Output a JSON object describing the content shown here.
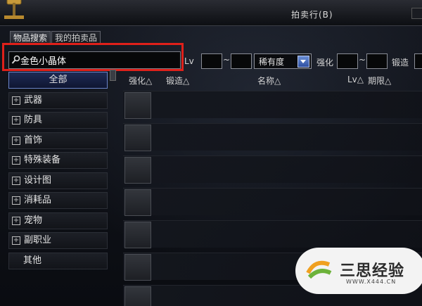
{
  "window": {
    "title": "拍卖行(B)"
  },
  "tabs": [
    {
      "label": "物品搜索"
    },
    {
      "label": "我的拍卖品"
    }
  ],
  "search": {
    "value": "金色小晶体"
  },
  "filters": {
    "lv_label": "Lv",
    "tilde": "~",
    "rarity_label": "稀有度",
    "enhance_label": "强化",
    "forge_label": "锻造"
  },
  "categories": [
    {
      "label": "全部",
      "selected": true
    },
    {
      "label": "武器"
    },
    {
      "label": "防具"
    },
    {
      "label": "首饰"
    },
    {
      "label": "特殊装备"
    },
    {
      "label": "设计图"
    },
    {
      "label": "消耗品"
    },
    {
      "label": "宠物"
    },
    {
      "label": "副职业"
    },
    {
      "label": "其他"
    }
  ],
  "columns": {
    "enhance": "强化△",
    "forge": "锻造△",
    "name": "名称△",
    "lv": "Lv△",
    "period": "期限△"
  },
  "rows_count": 7,
  "watermark": {
    "text": "三思经验",
    "url": "WWW.X444.CN"
  },
  "colors": {
    "highlight": "#e0201a",
    "accent": "#2e4fa1"
  }
}
